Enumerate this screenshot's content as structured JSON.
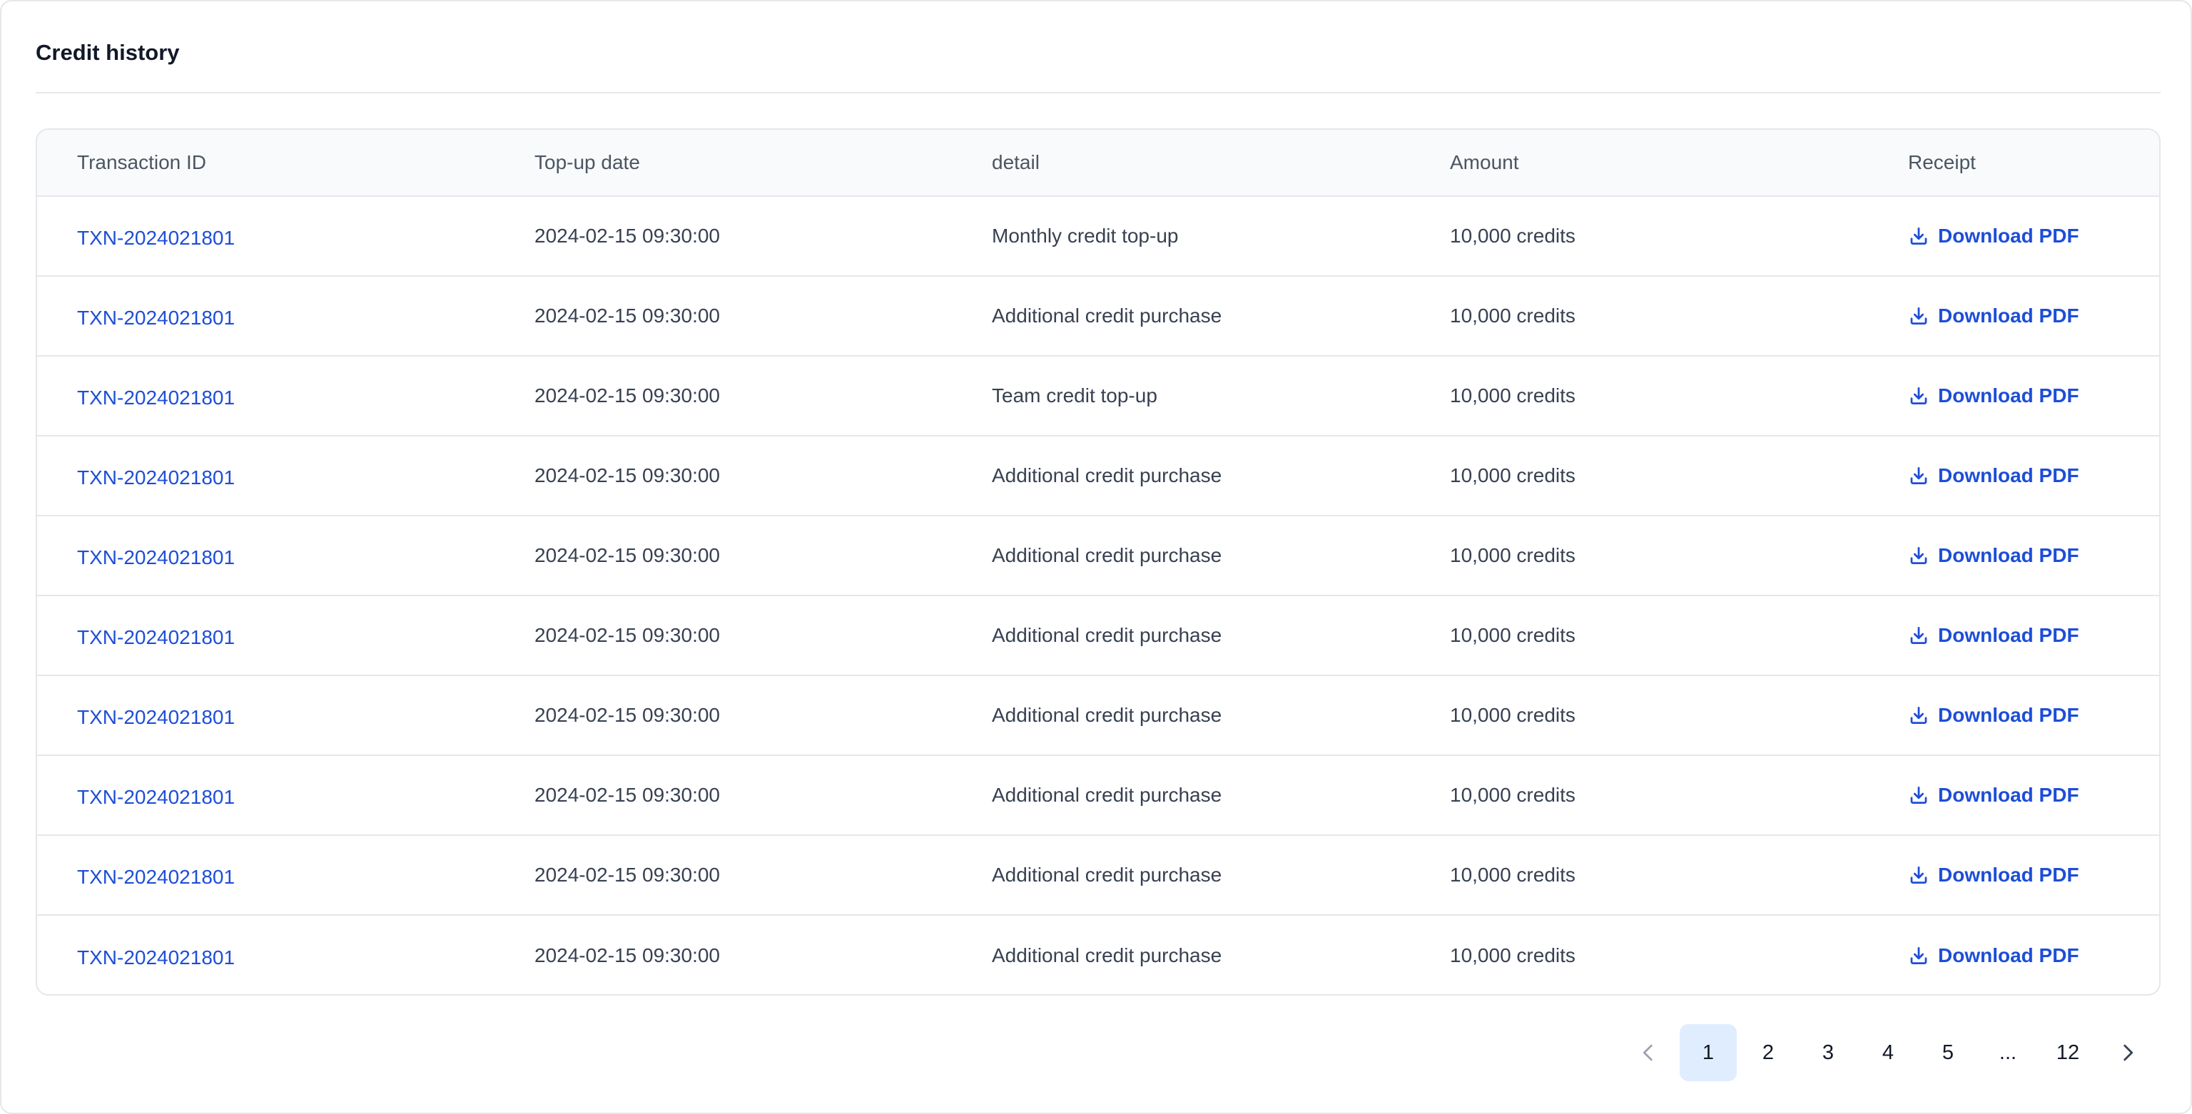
{
  "panel": {
    "title": "Credit history"
  },
  "table": {
    "columns": [
      "Transaction ID",
      "Top-up date",
      "detail",
      "Amount",
      "Receipt"
    ],
    "rows": [
      {
        "id": "TXN-2024021801",
        "date": "2024-02-15 09:30:00",
        "detail": "Monthly credit top-up",
        "amount": "10,000 credits",
        "receipt": "Download PDF"
      },
      {
        "id": "TXN-2024021801",
        "date": "2024-02-15 09:30:00",
        "detail": "Additional credit purchase",
        "amount": "10,000 credits",
        "receipt": "Download PDF"
      },
      {
        "id": "TXN-2024021801",
        "date": "2024-02-15 09:30:00",
        "detail": "Team credit top-up",
        "amount": "10,000 credits",
        "receipt": "Download PDF"
      },
      {
        "id": "TXN-2024021801",
        "date": "2024-02-15 09:30:00",
        "detail": "Additional credit purchase",
        "amount": "10,000 credits",
        "receipt": "Download PDF"
      },
      {
        "id": "TXN-2024021801",
        "date": "2024-02-15 09:30:00",
        "detail": "Additional credit purchase",
        "amount": "10,000 credits",
        "receipt": "Download PDF"
      },
      {
        "id": "TXN-2024021801",
        "date": "2024-02-15 09:30:00",
        "detail": "Additional credit purchase",
        "amount": "10,000 credits",
        "receipt": "Download PDF"
      },
      {
        "id": "TXN-2024021801",
        "date": "2024-02-15 09:30:00",
        "detail": "Additional credit purchase",
        "amount": "10,000 credits",
        "receipt": "Download PDF"
      },
      {
        "id": "TXN-2024021801",
        "date": "2024-02-15 09:30:00",
        "detail": "Additional credit purchase",
        "amount": "10,000 credits",
        "receipt": "Download PDF"
      },
      {
        "id": "TXN-2024021801",
        "date": "2024-02-15 09:30:00",
        "detail": "Additional credit purchase",
        "amount": "10,000 credits",
        "receipt": "Download PDF"
      },
      {
        "id": "TXN-2024021801",
        "date": "2024-02-15 09:30:00",
        "detail": "Additional credit purchase",
        "amount": "10,000 credits",
        "receipt": "Download PDF"
      }
    ],
    "receipt_icon": "download-icon"
  },
  "pagination": {
    "prev_icon": "chevron-left-icon",
    "next_icon": "chevron-right-icon",
    "pages": [
      "1",
      "2",
      "3",
      "4",
      "5",
      "...",
      "12"
    ],
    "current": "1"
  },
  "colors": {
    "link": "#1d4ed8",
    "active_page_bg": "#e0edff",
    "border": "#e5e7eb",
    "header_bg": "#f9fafb"
  }
}
